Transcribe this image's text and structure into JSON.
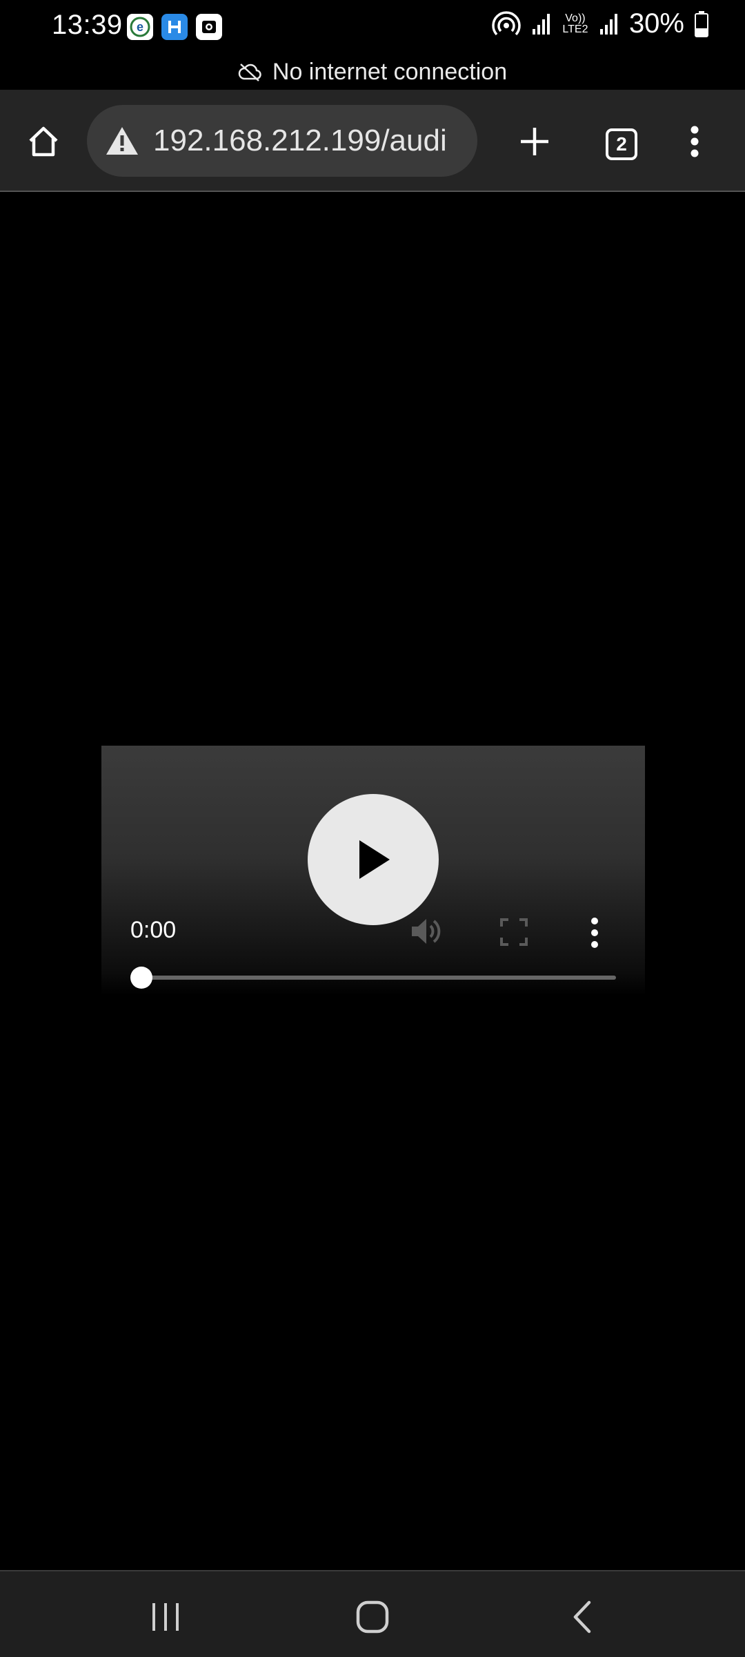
{
  "status_bar": {
    "time": "13:39",
    "battery": "30%",
    "network_label": "Vo)) LTE2"
  },
  "offline_banner": {
    "text": "No internet connection",
    "icon": "cloud-off-icon"
  },
  "toolbar": {
    "url": "192.168.212.199/audi",
    "tab_count": "2",
    "url_warning_icon": "warning-icon"
  },
  "player": {
    "current_time": "0:00",
    "progress": 0
  },
  "colors": {
    "toolbar_bg": "#252525",
    "url_bg": "#3a3a3a",
    "play_button": "#e8e8e8",
    "nav_bg": "#1f1f1f"
  }
}
